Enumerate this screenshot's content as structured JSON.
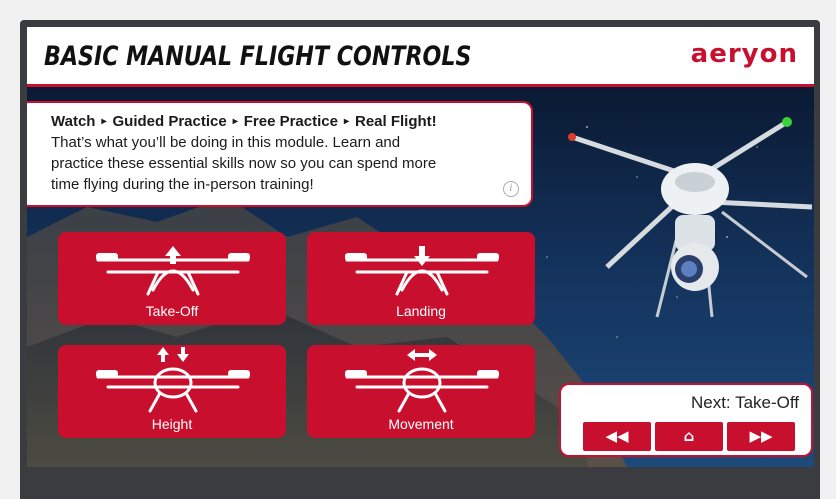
{
  "header": {
    "title": "BASIC MANUAL FLIGHT CONTROLS",
    "logo": "aeryon"
  },
  "intro": {
    "steps": [
      "Watch",
      "Guided Practice",
      "Free Practice",
      "Real Flight!"
    ],
    "step_separator": "▸",
    "line1": "That’s what you’ll be doing in this module. Learn and",
    "line2": "practice these essential skills now so you can spend more",
    "line3": "time flying during the in-person training!",
    "info_icon": "info-icon"
  },
  "controls": [
    {
      "label": "Take-Off",
      "icon": "drone-up-arrow-icon"
    },
    {
      "label": "Landing",
      "icon": "drone-down-arrow-icon"
    },
    {
      "label": "Height",
      "icon": "drone-vertical-arrows-icon"
    },
    {
      "label": "Movement",
      "icon": "drone-horizontal-arrows-icon"
    }
  ],
  "nav": {
    "next_label": "Next: Take-Off",
    "back_icon": "rewind-icon",
    "home_icon": "home-icon",
    "forward_icon": "fast-forward-icon"
  },
  "colors": {
    "brand_red": "#c8102e",
    "frame_gray": "#3a3c40",
    "sky_dark": "#0d2240"
  }
}
